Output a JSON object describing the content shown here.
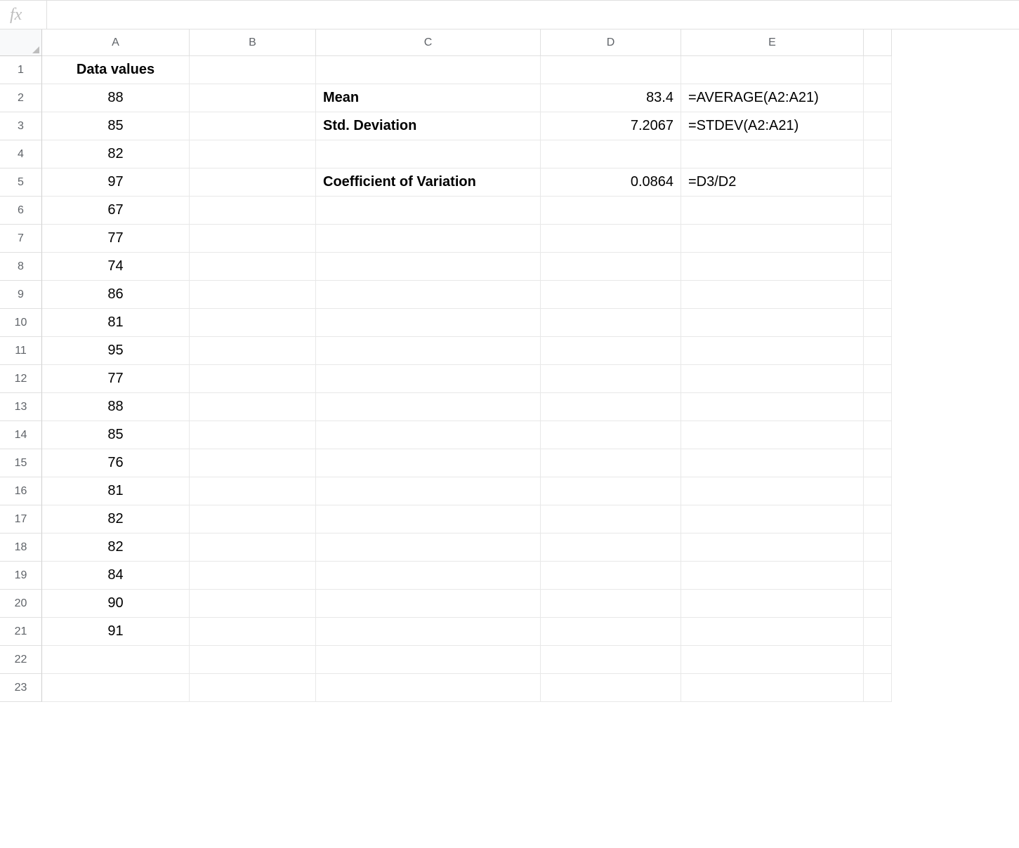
{
  "formula_bar": {
    "fx_label": "fx",
    "input_value": ""
  },
  "columns": [
    "A",
    "B",
    "C",
    "D",
    "E",
    ""
  ],
  "rows": [
    "1",
    "2",
    "3",
    "4",
    "5",
    "6",
    "7",
    "8",
    "9",
    "10",
    "11",
    "12",
    "13",
    "14",
    "15",
    "16",
    "17",
    "18",
    "19",
    "20",
    "21",
    "22",
    "23"
  ],
  "header_A": "Data values",
  "data_values": [
    "88",
    "85",
    "82",
    "97",
    "67",
    "77",
    "74",
    "86",
    "81",
    "95",
    "77",
    "88",
    "85",
    "76",
    "81",
    "82",
    "82",
    "84",
    "90",
    "91"
  ],
  "labels": {
    "mean": "Mean",
    "std": "Std. Deviation",
    "cv": "Coefficient of  Variation"
  },
  "results": {
    "mean": "83.4",
    "std": "7.2067",
    "cv": "0.0864"
  },
  "formulas": {
    "mean": "=AVERAGE(A2:A21)",
    "std": "=STDEV(A2:A21)",
    "cv": "=D3/D2"
  }
}
